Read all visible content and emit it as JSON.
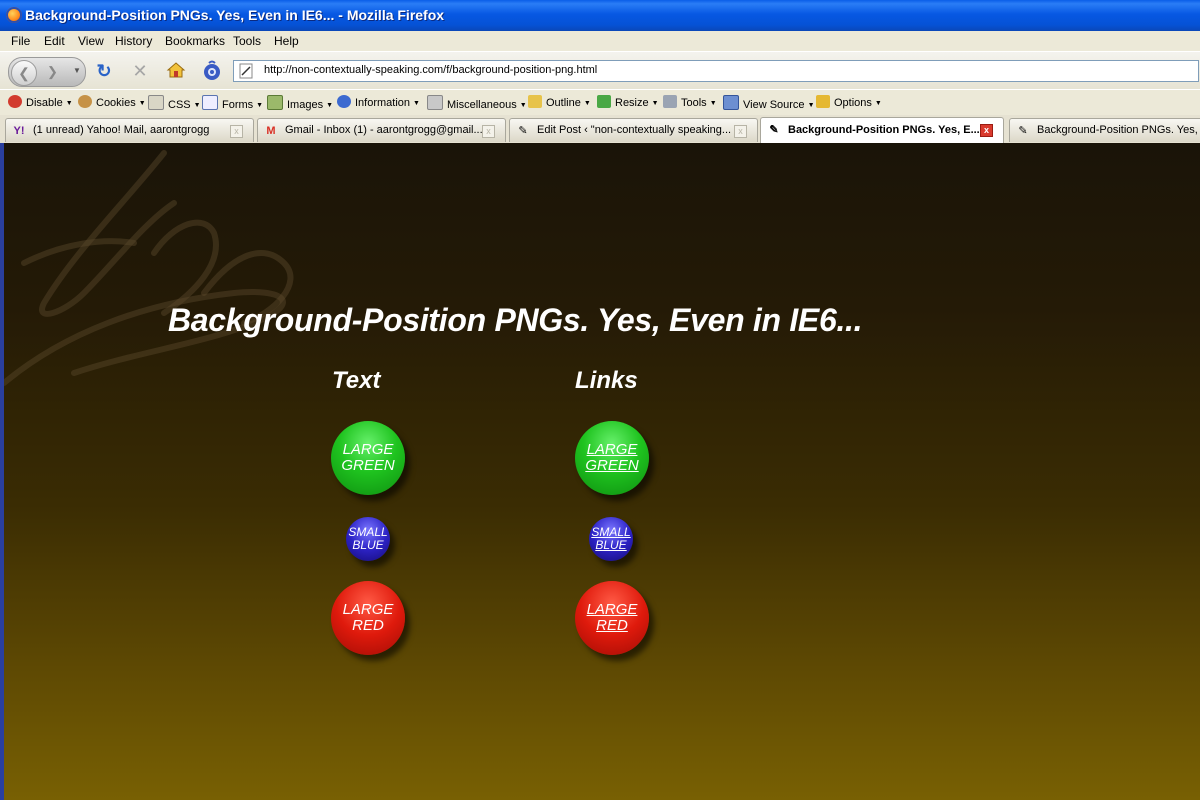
{
  "window": {
    "title": "Background-Position PNGs. Yes, Even in IE6... - Mozilla Firefox"
  },
  "menu": [
    "File",
    "Edit",
    "View",
    "History",
    "Bookmarks",
    "Tools",
    "Help"
  ],
  "nav": {
    "url": "http://non-contextually-speaking.com/f/background-position-png.html"
  },
  "devtoolbar": [
    "Disable",
    "Cookies",
    "CSS",
    "Forms",
    "Images",
    "Information",
    "Miscellaneous",
    "Outline",
    "Resize",
    "Tools",
    "View Source",
    "Options"
  ],
  "tabs": [
    {
      "label": "(1 unread) Yahoo! Mail, aarontgrogg",
      "active": false
    },
    {
      "label": "Gmail - Inbox (1) - aarontgrogg@gmail....",
      "active": false
    },
    {
      "label": "Edit Post ‹ \"non-contextually speaking...",
      "active": false
    },
    {
      "label": "Background-Position PNGs. Yes, E...",
      "active": true
    },
    {
      "label": "Background-Position PNGs. Yes, Ev",
      "active": false
    }
  ],
  "page": {
    "heading": "Background-Position PNGs. Yes, Even in IE6...",
    "text_col": {
      "title": "Text",
      "large_green": [
        "LARGE",
        "GREEN"
      ],
      "small_blue": [
        "SMALL",
        "BLUE"
      ],
      "large_red": [
        "LARGE",
        "RED"
      ]
    },
    "links_col": {
      "title": "Links",
      "large_green": [
        "LARGE",
        "GREEN"
      ],
      "small_blue": [
        "SMALL",
        "BLUE"
      ],
      "large_red": [
        "LARGE",
        "RED"
      ]
    }
  }
}
